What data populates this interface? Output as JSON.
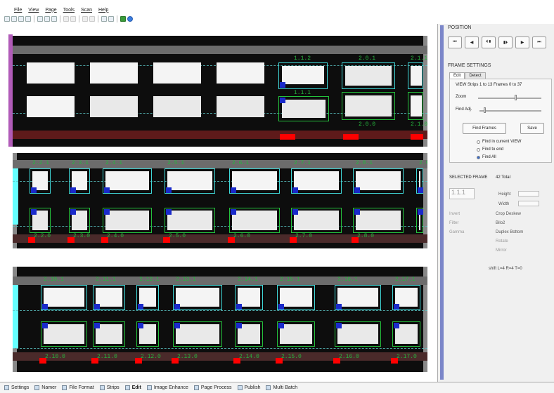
{
  "menu": [
    "File",
    "View",
    "Page",
    "Tools",
    "Scan",
    "Help"
  ],
  "toolbar": {
    "icons": [
      "new-icon",
      "open-icon",
      "save-icon",
      "print-icon",
      "sep",
      "scan-icon",
      "rescan-icon",
      "refresh-icon",
      "sep",
      "zoom-in-icon",
      "zoom-out-icon",
      "sep",
      "grid-icon",
      "grid2-icon",
      "sep",
      "plus-icon",
      "diamond-icon",
      "sep",
      "green-icon",
      "help-icon"
    ]
  },
  "strips": [
    {
      "labels_top": [
        "1.1.2",
        "2.0.1",
        "2.1.1"
      ],
      "labels_mid": [
        "1.1.1"
      ],
      "labels_bottom": [
        "2.0.0",
        "2.1.0"
      ]
    },
    {
      "labels_top": [
        "2.2.1",
        "2.3.1",
        "2.4.1",
        "2.5.1",
        "2.6.1",
        "2.7.1",
        "2.8.1",
        "2.9.1"
      ],
      "labels_bottom": [
        "2.2.0",
        "2.3.0",
        "2.4.0",
        "2.5.0",
        "2.6.0",
        "2.7.0",
        "2.8.0"
      ]
    },
    {
      "labels_top": [
        "2.10.1",
        "2.11.1",
        "2.12.1",
        "2.13.1",
        "2.14.1",
        "2.15.1",
        "2.16.1",
        "2.17.1"
      ],
      "labels_bottom": [
        "2.10.0",
        "2.11.0",
        "2.12.0",
        "2.13.0",
        "2.14.0",
        "2.15.0",
        "2.16.0",
        "2.17.0"
      ]
    }
  ],
  "panel": {
    "position_title": "POSITION",
    "nav_buttons": [
      "first-icon",
      "prev-icon",
      "frame-prev-icon",
      "frame-next-icon",
      "next-icon",
      "last-icon"
    ],
    "nav_glyphs": [
      "⏮",
      "◀",
      "⏴▮",
      "▮⏵",
      "▶",
      "⏭"
    ],
    "frame_settings_title": "FRAME SETTINGS",
    "tabs": [
      "Edit",
      "Detect"
    ],
    "view_info": "VIEW Strips 1 to 13  Frames 0 to 37",
    "zoom_label": "Zoom",
    "find_adj_label": "Find Adj.",
    "find_frames_label": "Find Frames",
    "save_label": "Save",
    "radios": [
      "Find in current VIEW",
      "Find to end",
      "Find All"
    ],
    "selected_radio": 2,
    "selected_frame_title": "SELECTED FRAME",
    "total": "42 Total",
    "frame_id": "1.1.1",
    "height_label": "Height",
    "width_label": "Width",
    "invert_label": "Invert",
    "crop_deskew_label": "Crop Deskew",
    "filter_label": "Filter",
    "filter_value": "Bilo2",
    "gamma_label": "Gamma",
    "duplex_label": "Duplex Bottom",
    "rotate_label": "Rotate",
    "mirror_label": "Mirror",
    "shift_info": "shift L=4 R=4 T=0"
  },
  "bottom_tabs": [
    "Settings",
    "Namer",
    "File Format",
    "Strips",
    "Edit",
    "Image Enhance",
    "Page Process",
    "Publish",
    "Multi Batch"
  ],
  "active_tab": "Edit"
}
